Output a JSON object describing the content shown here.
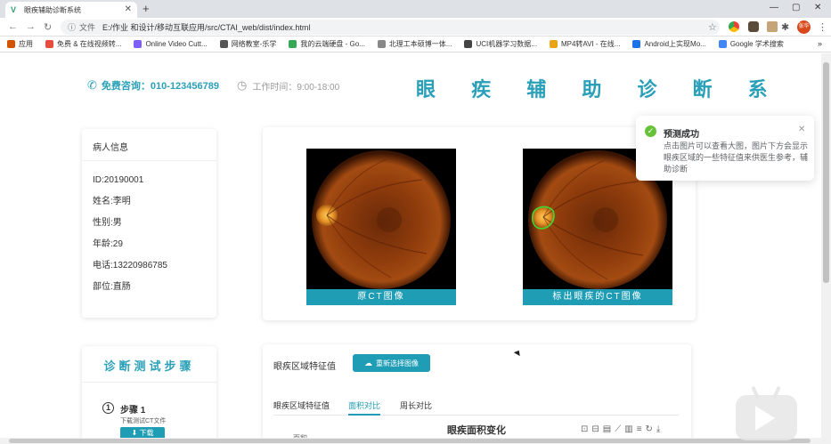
{
  "browser": {
    "tab_title": "眼疾辅助诊断系统",
    "new_tab": "+",
    "address_label": "文件",
    "url": "E:/作业 和设计/移动互联应用/src/CTAI_web/dist/index.html",
    "avatar_text": "张华",
    "bookmarks": [
      {
        "label": "应用",
        "color": "#d35400"
      },
      {
        "label": "免费 & 在线视频转...",
        "color": "#e74c3c"
      },
      {
        "label": "Online Video Cutt...",
        "color": "#7d5fff"
      },
      {
        "label": "网络教室-乐学",
        "color": "#555555"
      },
      {
        "label": "我的云端硬盘 - Go...",
        "color": "#34a853"
      },
      {
        "label": "北理工本硕博一体...",
        "color": "#888888"
      },
      {
        "label": "UCI机器学习数据...",
        "color": "#444444"
      },
      {
        "label": "MP4转AVI - 在线...",
        "color": "#e8a317"
      },
      {
        "label": "Android上实现Mo...",
        "color": "#1a73e8"
      },
      {
        "label": "Google 学术搜索",
        "color": "#4285f4"
      }
    ],
    "bookmarks_more": "»"
  },
  "header": {
    "hotline": "免费咨询：010-123456789",
    "worktime": "工作时间：9:00-18:00",
    "title": "眼 疾 辅 助 诊 断 系"
  },
  "patient": {
    "title": "病人信息",
    "rows": [
      "ID:20190001",
      "姓名:李明",
      "性别:男",
      "年龄:29",
      "电话:13220986785",
      "部位:直肠"
    ]
  },
  "images": {
    "original_caption": "原CT图像",
    "marked_caption": "标出眼疾的CT图像"
  },
  "steps": {
    "title": "诊断测试步骤",
    "step1_num": "1",
    "step1_name": "步骤 1",
    "step1_desc": "下载测试CT文件",
    "step1_button": "下载"
  },
  "features": {
    "label": "眼疾区域特征值",
    "reselect_button": "重新选择图像",
    "tabs": [
      "眼疾区域特征值",
      "面积对比",
      "周长对比"
    ],
    "active_tab": 1,
    "chart_title": "眼疾面积变化",
    "chart_ylabel": "面积"
  },
  "toast": {
    "title": "预测成功",
    "message": "点击图片可以查看大图，图片下方会显示眼疾区域的一些特征值来供医生参考，辅助诊断"
  },
  "colors": {
    "accent": "#1f9db5",
    "success": "#67c23a"
  }
}
